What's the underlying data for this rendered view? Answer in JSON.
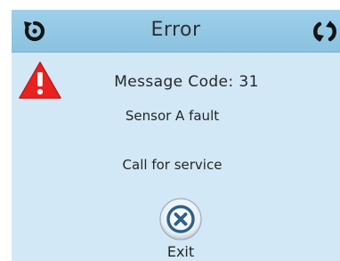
{
  "header": {
    "title": "Error",
    "back_icon": "undo-icon",
    "refresh_icon": "refresh-icon"
  },
  "alert": {
    "icon": "warning-triangle-icon",
    "message_code": "Message Code: 31",
    "fault_text": "Sensor A fault",
    "instruction": "Call for service"
  },
  "footer": {
    "exit_icon": "close-circle-icon",
    "exit_label": "Exit"
  },
  "colors": {
    "screen_bg": "#d2e8f6",
    "titlebar_bg": "#8ac2e0",
    "warning_red": "#e8231f",
    "exit_blue": "#2f5f8a"
  }
}
